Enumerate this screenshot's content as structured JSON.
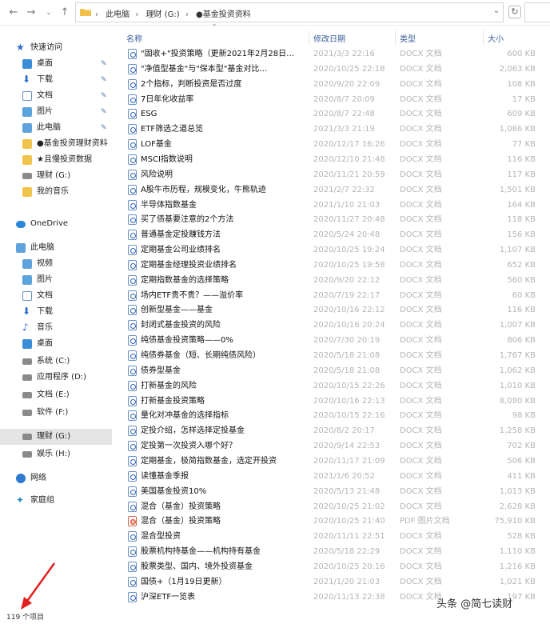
{
  "address": {
    "breadcrumb": [
      "此电脑",
      "理财 (G:)",
      "●基金投资资料"
    ]
  },
  "columns": {
    "name": "名称",
    "date": "修改日期",
    "type": "类型",
    "size": "大小"
  },
  "sidebar": {
    "quick_access": "快速访问",
    "qa_items": [
      "桌面",
      "下载",
      "文档",
      "图片",
      "此电脑",
      "●基金投资理财资料",
      "★且慢投资数据",
      "理财 (G:)",
      "我的音乐"
    ],
    "onedrive": "OneDrive",
    "this_pc": "此电脑",
    "pc_items": [
      "视频",
      "图片",
      "文档",
      "下载",
      "音乐",
      "桌面",
      "系统 (C:)",
      "应用程序 (D:)",
      "文档 (E:)",
      "软件 (F:)",
      "理财 (G:)",
      "娱乐 (H:)"
    ],
    "network": "网络",
    "homegroup": "家庭组"
  },
  "files": [
    {
      "name": "\"固收+\"投资策略（更新2021年2月28日…",
      "date": "2021/3/3 22:16",
      "type": "DOCX 文档",
      "size": "600 KB",
      "pdf": false
    },
    {
      "name": "\"净值型基金\"与\"保本型\"基金对比…",
      "date": "2020/10/25 22:18",
      "type": "DOCX 文档",
      "size": "2,063 KB",
      "pdf": false
    },
    {
      "name": "2个指标，判断投资是否过度",
      "date": "2020/9/20 22:09",
      "type": "DOCX 文档",
      "size": "108 KB",
      "pdf": false
    },
    {
      "name": "7日年化收益率",
      "date": "2020/8/7 20:09",
      "type": "DOCX 文档",
      "size": "17 KB",
      "pdf": false
    },
    {
      "name": "ESG",
      "date": "2020/8/7 22:48",
      "type": "DOCX 文档",
      "size": "609 KB",
      "pdf": false
    },
    {
      "name": "ETF筛选之道总览",
      "date": "2021/3/3 21:19",
      "type": "DOCX 文档",
      "size": "1,086 KB",
      "pdf": false
    },
    {
      "name": "LOF基金",
      "date": "2020/12/17 16:26",
      "type": "DOCX 文档",
      "size": "77 KB",
      "pdf": false
    },
    {
      "name": "MSCI指数说明",
      "date": "2020/12/10 21:48",
      "type": "DOCX 文档",
      "size": "116 KB",
      "pdf": false
    },
    {
      "name": "风险说明",
      "date": "2020/11/21 20:59",
      "type": "DOCX 文档",
      "size": "117 KB",
      "pdf": false
    },
    {
      "name": "A股牛市历程，规模变化，牛熊轨迹",
      "date": "2021/2/7 22:32",
      "type": "DOCX 文档",
      "size": "1,501 KB",
      "pdf": false
    },
    {
      "name": "半导体指数基金",
      "date": "2021/1/10 21:03",
      "type": "DOCX 文档",
      "size": "164 KB",
      "pdf": false
    },
    {
      "name": "买了债基要注意的2个方法",
      "date": "2020/11/27 20:48",
      "type": "DOCX 文档",
      "size": "118 KB",
      "pdf": false
    },
    {
      "name": "普通基金定投赚钱方法",
      "date": "2020/5/24 20:48",
      "type": "DOCX 文档",
      "size": "156 KB",
      "pdf": false
    },
    {
      "name": "定期基金公司业绩排名",
      "date": "2020/10/25 19:24",
      "type": "DOCX 文档",
      "size": "1,107 KB",
      "pdf": false
    },
    {
      "name": "定期基金经理投资业绩排名",
      "date": "2020/10/25 19:58",
      "type": "DOCX 文档",
      "size": "652 KB",
      "pdf": false
    },
    {
      "name": "定期指数基金的选择策略",
      "date": "2020/9/20 22:12",
      "type": "DOCX 文档",
      "size": "560 KB",
      "pdf": false
    },
    {
      "name": "场内ETF贵不贵？——溢价率",
      "date": "2020/7/19 22:17",
      "type": "DOCX 文档",
      "size": "60 KB",
      "pdf": false
    },
    {
      "name": "创新型基金——基金",
      "date": "2020/10/16 22:12",
      "type": "DOCX 文档",
      "size": "116 KB",
      "pdf": false
    },
    {
      "name": "封闭式基金投资的风险",
      "date": "2020/10/16 20:24",
      "type": "DOCX 文档",
      "size": "1,007 KB",
      "pdf": false
    },
    {
      "name": "纯债基金投资策略——0%",
      "date": "2020/7/30 20:19",
      "type": "DOCX 文档",
      "size": "806 KB",
      "pdf": false
    },
    {
      "name": "纯债券基金（短、长期纯债风险）",
      "date": "2020/5/18 21:08",
      "type": "DOCX 文档",
      "size": "1,767 KB",
      "pdf": false
    },
    {
      "name": "债券型基金",
      "date": "2020/5/18 21:08",
      "type": "DOCX 文档",
      "size": "1,062 KB",
      "pdf": false
    },
    {
      "name": "打新基金的风险",
      "date": "2020/10/15 22:26",
      "type": "DOCX 文档",
      "size": "1,010 KB",
      "pdf": false
    },
    {
      "name": "打新基金投资策略",
      "date": "2020/10/16 22:13",
      "type": "DOCX 文档",
      "size": "8,080 KB",
      "pdf": false
    },
    {
      "name": "量化对冲基金的选择指标",
      "date": "2020/10/15 22:16",
      "type": "DOCX 文档",
      "size": "98 KB",
      "pdf": false
    },
    {
      "name": "定投介绍，怎样选择定投基金",
      "date": "2020/8/2 20:17",
      "type": "DOCX 文档",
      "size": "1,258 KB",
      "pdf": false
    },
    {
      "name": "定投第一次投资入哪个好？",
      "date": "2020/9/14 22:53",
      "type": "DOCX 文档",
      "size": "702 KB",
      "pdf": false
    },
    {
      "name": "定期基金，极简指数基金，选定开投资",
      "date": "2020/11/17 21:09",
      "type": "DOCX 文档",
      "size": "506 KB",
      "pdf": false
    },
    {
      "name": "读懂基金季报",
      "date": "2021/1/6 20:52",
      "type": "DOCX 文档",
      "size": "411 KB",
      "pdf": false
    },
    {
      "name": "美国基金投资10%",
      "date": "2020/5/13 21:48",
      "type": "DOCX 文档",
      "size": "1,013 KB",
      "pdf": false
    },
    {
      "name": "混合（基金）投资策略",
      "date": "2020/10/25 21:02",
      "type": "DOCX 文档",
      "size": "2,628 KB",
      "pdf": false
    },
    {
      "name": "混合（基金）投资策略",
      "date": "2020/10/25 21:40",
      "type": "PDF 图片文档",
      "size": "75,910 KB",
      "pdf": true
    },
    {
      "name": "混合型投资",
      "date": "2020/11/11 22:51",
      "type": "DOCX 文档",
      "size": "528 KB",
      "pdf": false
    },
    {
      "name": "股票机构持基金——机构持有基金",
      "date": "2020/5/18 22:29",
      "type": "DOCX 文档",
      "size": "1,110 KB",
      "pdf": false
    },
    {
      "name": "股票类型、国内、境外投资基金",
      "date": "2020/10/25 20:16",
      "type": "DOCX 文档",
      "size": "1,216 KB",
      "pdf": false
    },
    {
      "name": "国债+（1月19日更新）",
      "date": "2021/1/20 21:03",
      "type": "DOCX 文档",
      "size": "1,021 KB",
      "pdf": false
    },
    {
      "name": "沪深ETF一览表",
      "date": "2020/11/13 22:38",
      "type": "DOCX 文档",
      "size": "197 KB",
      "pdf": false
    }
  ],
  "status": {
    "count": "119 个项目"
  },
  "watermark": "头条 @简七读财"
}
